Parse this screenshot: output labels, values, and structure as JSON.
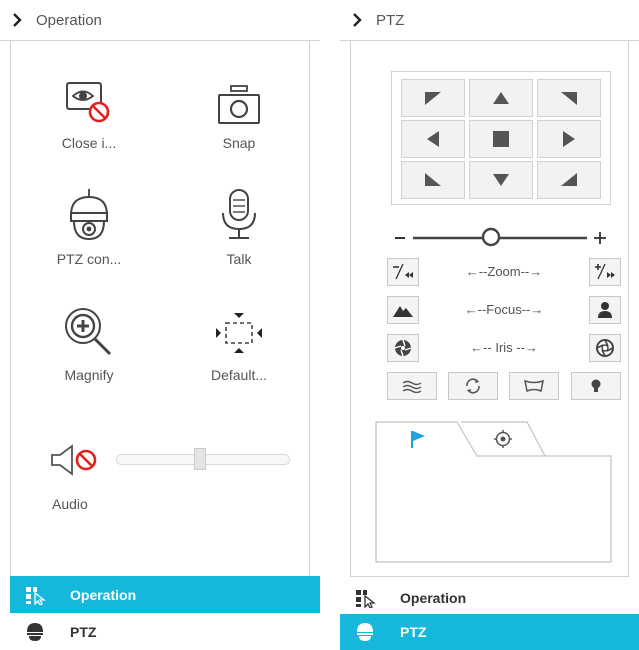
{
  "left_panel": {
    "header_title": "Operation",
    "ops": [
      {
        "label": "Close i...",
        "icon": "close-image-icon"
      },
      {
        "label": "Snap",
        "icon": "camera-icon"
      },
      {
        "label": "PTZ con...",
        "icon": "ptz-camera-icon"
      },
      {
        "label": "Talk",
        "icon": "microphone-icon"
      },
      {
        "label": "Magnify",
        "icon": "magnify-icon"
      },
      {
        "label": "Default...",
        "icon": "default-view-icon"
      }
    ],
    "audio": {
      "label": "Audio",
      "level": 0.51,
      "muted": true
    }
  },
  "right_panel": {
    "header_title": "PTZ",
    "zoom_slider_level": 0.42,
    "zoom_label": "←--Zoom--→",
    "focus_label": "←--Focus--→",
    "iris_label": "←-- Iris --→",
    "tabs": [
      {
        "icon": "flag-icon",
        "active": true
      },
      {
        "icon": "cruise-icon",
        "active": false
      }
    ]
  },
  "nav": {
    "operation": "Operation",
    "ptz": "PTZ"
  },
  "colors": {
    "accent": "#15b7da",
    "border": "#cfd3d6",
    "mute_red": "#e0201b",
    "flag_blue": "#1fa3d9"
  }
}
